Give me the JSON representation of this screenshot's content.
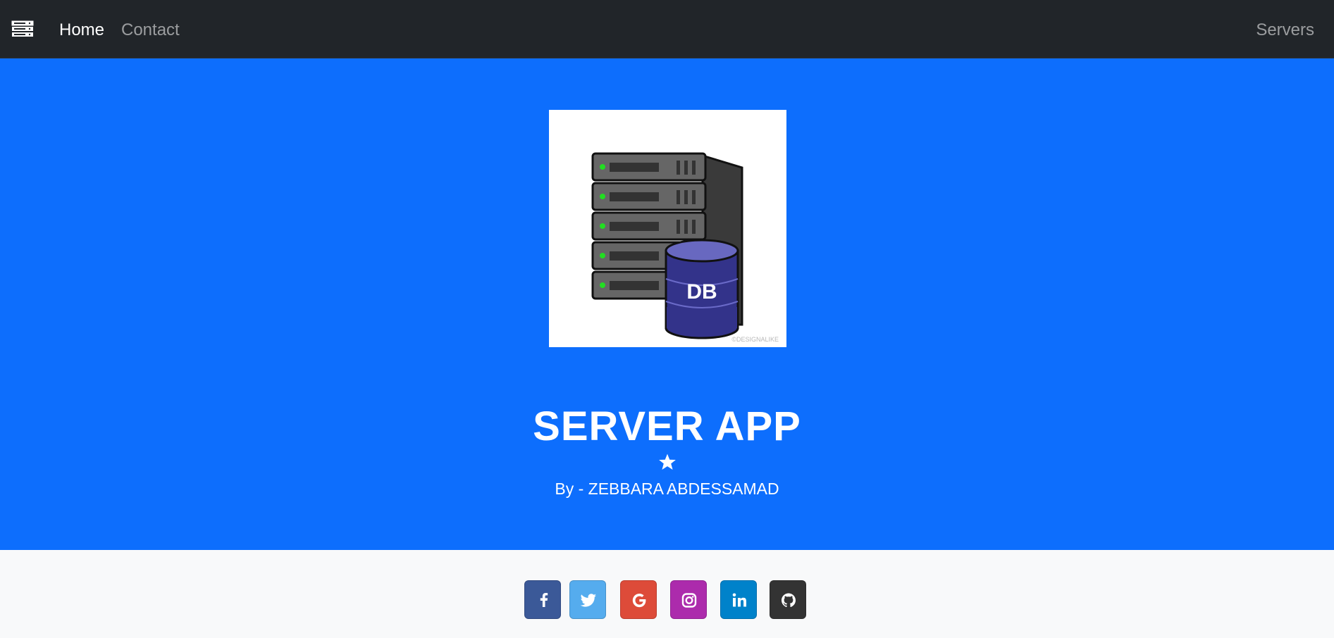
{
  "navbar": {
    "brand_icon": "server-rack-icon",
    "links": [
      {
        "label": "Home",
        "active": true
      },
      {
        "label": "Contact",
        "active": false
      }
    ],
    "right_link": "Servers"
  },
  "hero": {
    "image": {
      "icon": "database-server-illustration",
      "badge_text": "DB",
      "watermark": "©DESIGNALIKE"
    },
    "title": "SERVER APP",
    "divider_icon": "star-icon",
    "byline": "By - ZEBBARA ABDESSAMAD"
  },
  "footer": {
    "social_buttons": [
      {
        "name": "facebook",
        "icon": "facebook-icon",
        "color": "#3b5998"
      },
      {
        "name": "twitter",
        "icon": "twitter-icon",
        "color": "#55acee"
      },
      {
        "name": "google",
        "icon": "google-icon",
        "color": "#dd4b39"
      },
      {
        "name": "instagram",
        "icon": "instagram-icon",
        "color": "#ac2bac"
      },
      {
        "name": "linkedin",
        "icon": "linkedin-icon",
        "color": "#0082ca"
      },
      {
        "name": "github",
        "icon": "github-icon",
        "color": "#333333"
      }
    ]
  }
}
